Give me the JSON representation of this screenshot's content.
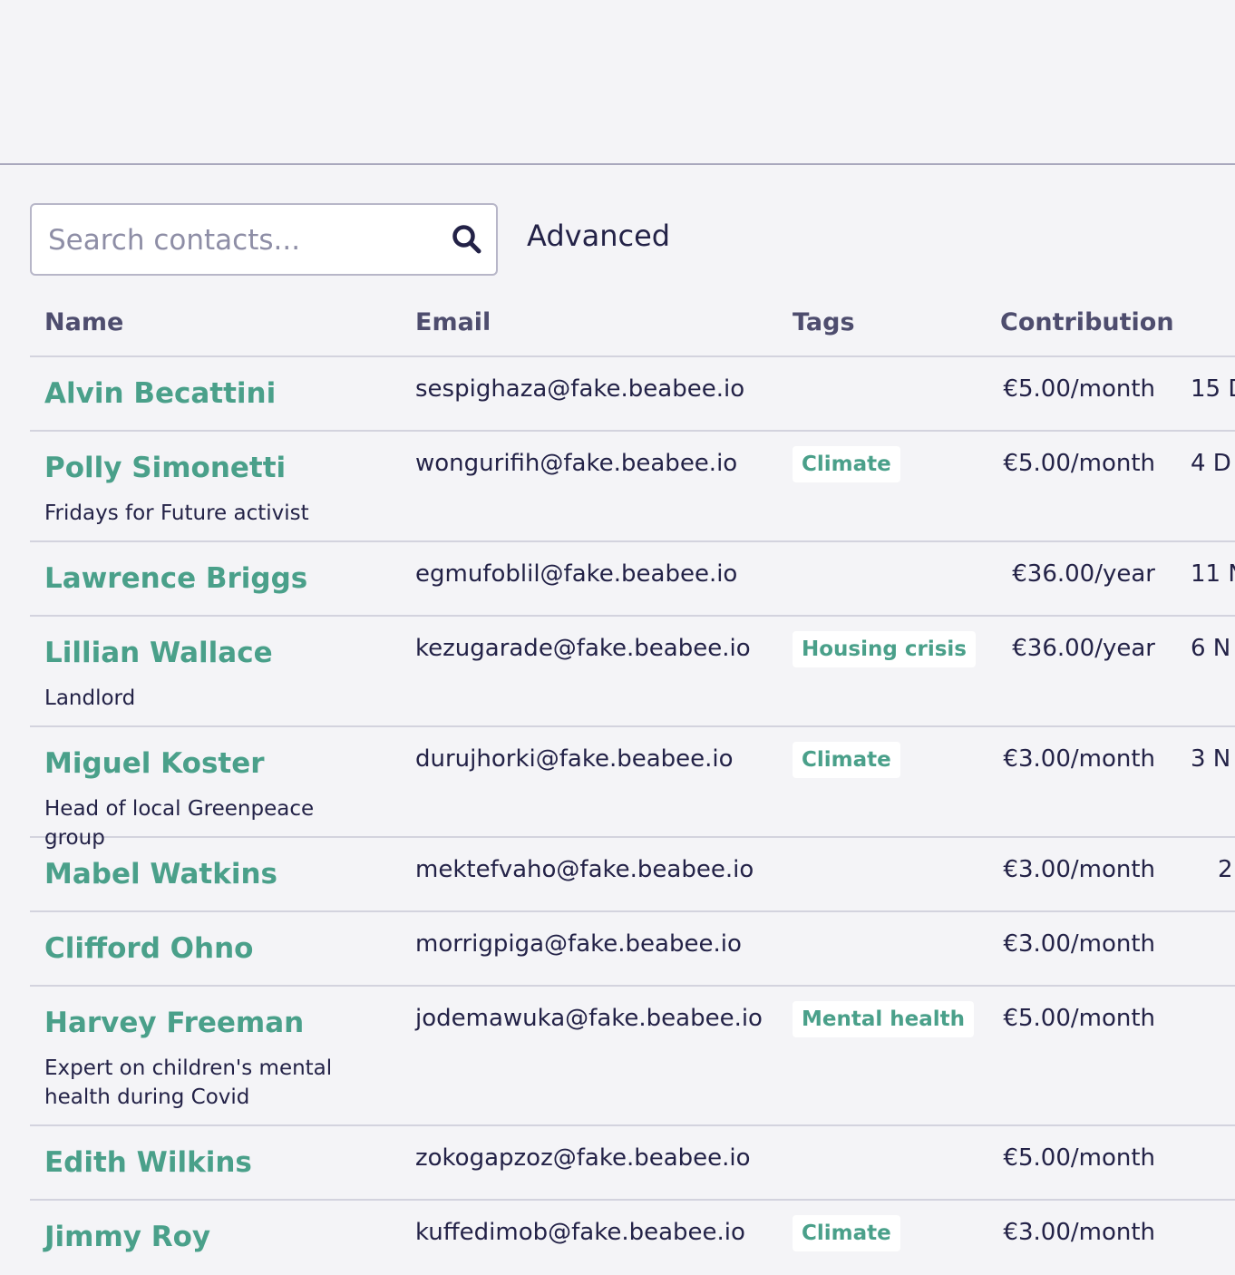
{
  "search": {
    "placeholder": "Search contacts...",
    "advanced_label": "Advanced"
  },
  "table": {
    "headers": {
      "name": "Name",
      "email": "Email",
      "tags": "Tags",
      "contribution": "Contribution"
    },
    "rows": [
      {
        "name": "Alvin Becattini",
        "description": "",
        "email": "sespighaza@fake.beabee.io",
        "tag": "",
        "contribution": "€5.00/month",
        "joined": "15 D"
      },
      {
        "name": "Polly Simonetti",
        "description": "Fridays for Future activist",
        "email": "wongurifih@fake.beabee.io",
        "tag": "Climate",
        "contribution": "€5.00/month",
        "joined": "4 D"
      },
      {
        "name": "Lawrence Briggs",
        "description": "",
        "email": "egmufoblil@fake.beabee.io",
        "tag": "",
        "contribution": "€36.00/year",
        "joined": "11 N"
      },
      {
        "name": "Lillian Wallace",
        "description": "Landlord",
        "email": "kezugarade@fake.beabee.io",
        "tag": "Housing crisis",
        "contribution": "€36.00/year",
        "joined": "6 N"
      },
      {
        "name": "Miguel Koster",
        "description": "Head of local Greenpeace group",
        "email": "durujhorki@fake.beabee.io",
        "tag": "Climate",
        "contribution": "€3.00/month",
        "joined": "3 N"
      },
      {
        "name": "Mabel Watkins",
        "description": "",
        "email": "mektefvaho@fake.beabee.io",
        "tag": "",
        "contribution": "€3.00/month",
        "joined": "2"
      },
      {
        "name": "Clifford Ohno",
        "description": "",
        "email": "morrigpiga@fake.beabee.io",
        "tag": "",
        "contribution": "€3.00/month",
        "joined": ""
      },
      {
        "name": "Harvey Freeman",
        "description": "Expert on children's mental health during Covid",
        "email": "jodemawuka@fake.beabee.io",
        "tag": "Mental health",
        "contribution": "€5.00/month",
        "joined": ""
      },
      {
        "name": "Edith Wilkins",
        "description": "",
        "email": "zokogapzoz@fake.beabee.io",
        "tag": "",
        "contribution": "€5.00/month",
        "joined": ""
      },
      {
        "name": "Jimmy Roy",
        "description": "",
        "email": "kuffedimob@fake.beabee.io",
        "tag": "Climate",
        "contribution": "€3.00/month",
        "joined": ""
      }
    ]
  },
  "colors": {
    "accent": "#4aa08a",
    "text": "#232247",
    "background": "#f4f4f7"
  },
  "icons": {
    "search": "search-icon"
  }
}
